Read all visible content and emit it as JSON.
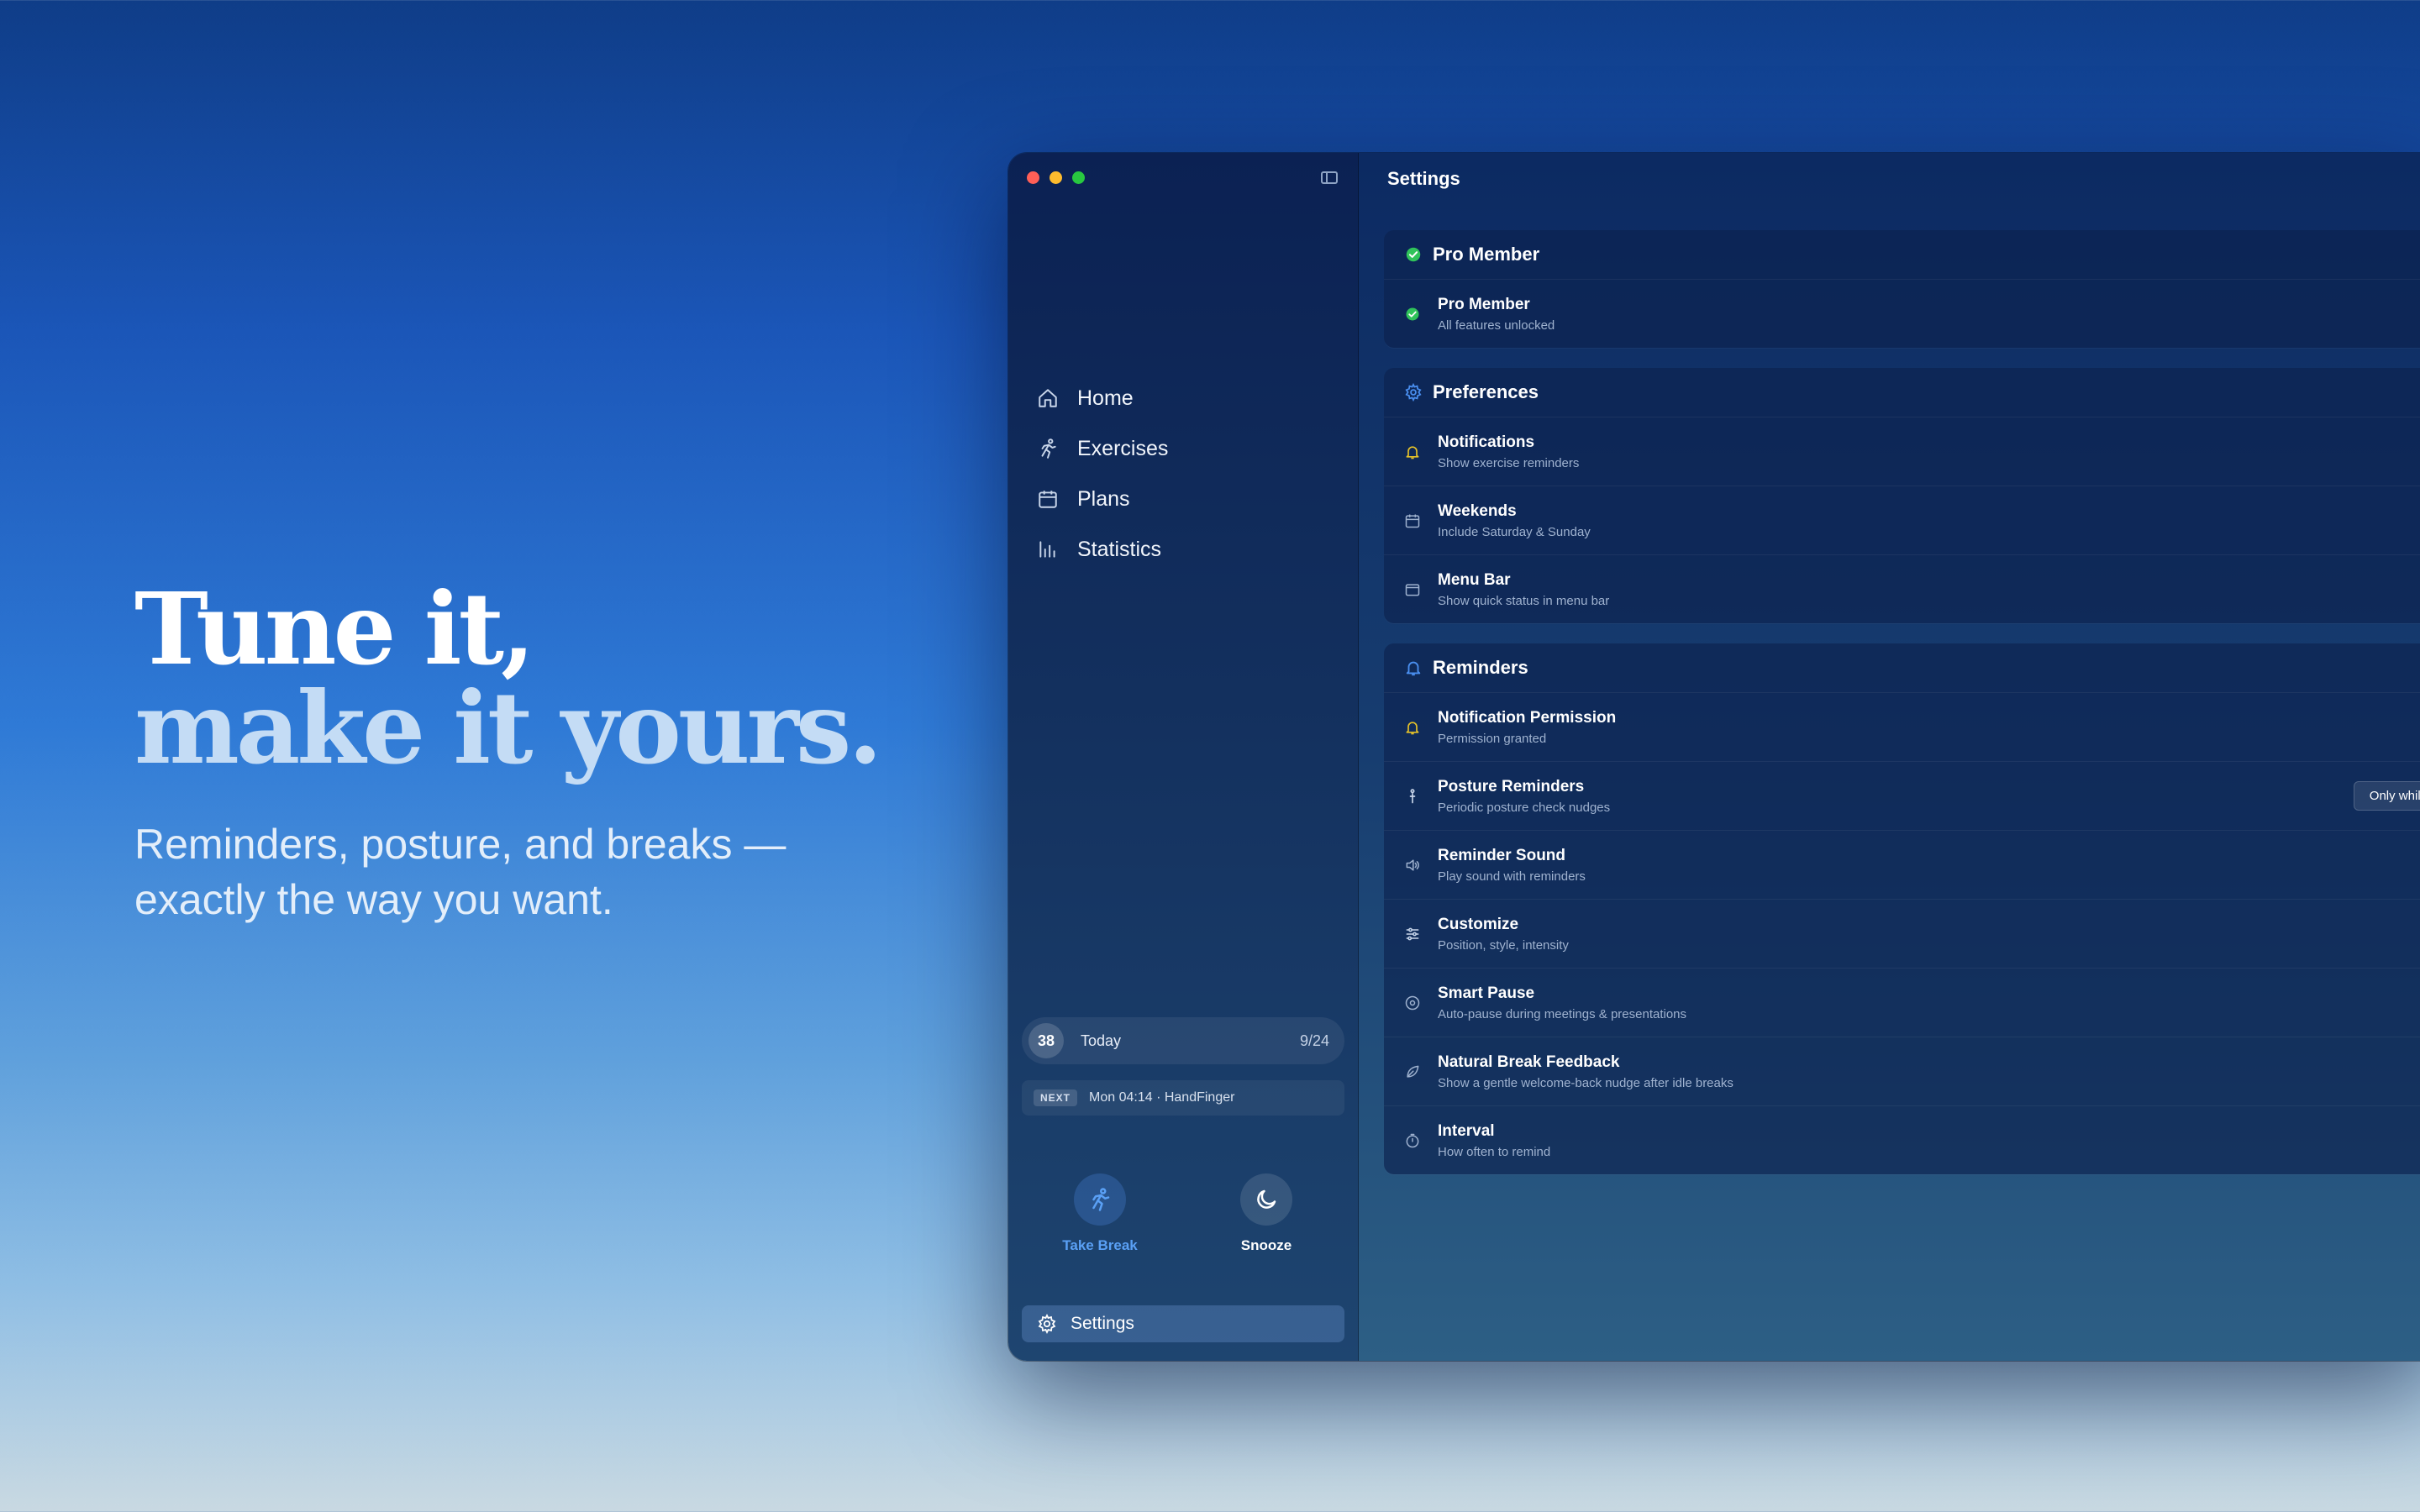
{
  "hero": {
    "title_line1": "Tune it,",
    "title_line2": "make it yours.",
    "subtitle": "Reminders, posture, and breaks — exactly the way you want."
  },
  "window": {
    "title": "Settings",
    "sidebar": {
      "nav": [
        {
          "label": "Home",
          "icon": "home-icon"
        },
        {
          "label": "Exercises",
          "icon": "running-icon"
        },
        {
          "label": "Plans",
          "icon": "calendar-icon"
        },
        {
          "label": "Statistics",
          "icon": "bar-chart-icon"
        }
      ],
      "today": {
        "count": "38",
        "label": "Today",
        "ratio": "9/24"
      },
      "next": {
        "badge": "NEXT",
        "text": "Mon 04:14 · HandFinger"
      },
      "actions": {
        "take_break": "Take Break",
        "snooze": "Snooze"
      },
      "settings_label": "Settings"
    },
    "groups": [
      {
        "title": "Pro Member",
        "icon": "check-circle-icon",
        "rows": [
          {
            "title": "Pro Member",
            "subtitle": "All features unlocked",
            "icon": "check-circle-icon"
          }
        ]
      },
      {
        "title": "Preferences",
        "icon": "gear-icon",
        "rows": [
          {
            "title": "Notifications",
            "subtitle": "Show exercise reminders",
            "icon": "bell-icon"
          },
          {
            "title": "Weekends",
            "subtitle": "Include Saturday & Sunday",
            "icon": "calendar-icon"
          },
          {
            "title": "Menu Bar",
            "subtitle": "Show quick status in menu bar",
            "icon": "menubar-icon"
          }
        ]
      },
      {
        "title": "Reminders",
        "icon": "bell-icon",
        "rows": [
          {
            "title": "Notification Permission",
            "subtitle": "Permission granted",
            "icon": "bell-icon"
          },
          {
            "title": "Posture Reminders",
            "subtitle": "Periodic posture check nudges",
            "icon": "posture-icon",
            "control": "Only while"
          },
          {
            "title": "Reminder Sound",
            "subtitle": "Play sound with reminders",
            "icon": "speaker-icon"
          },
          {
            "title": "Customize",
            "subtitle": "Position, style, intensity",
            "icon": "sliders-icon"
          },
          {
            "title": "Smart Pause",
            "subtitle": "Auto-pause during meetings & presentations",
            "icon": "pause-circle-icon"
          },
          {
            "title": "Natural Break Feedback",
            "subtitle": "Show a gentle welcome-back nudge after idle breaks",
            "icon": "leaf-icon"
          },
          {
            "title": "Interval",
            "subtitle": "How often to remind",
            "icon": "timer-icon"
          }
        ]
      }
    ]
  },
  "colors": {
    "accent": "#4a8ff0",
    "pro_green": "#30c35a",
    "bell_yellow": "#e6c229",
    "traffic_red": "#ff5f57",
    "traffic_yellow": "#febc2e",
    "traffic_green": "#28c840"
  }
}
